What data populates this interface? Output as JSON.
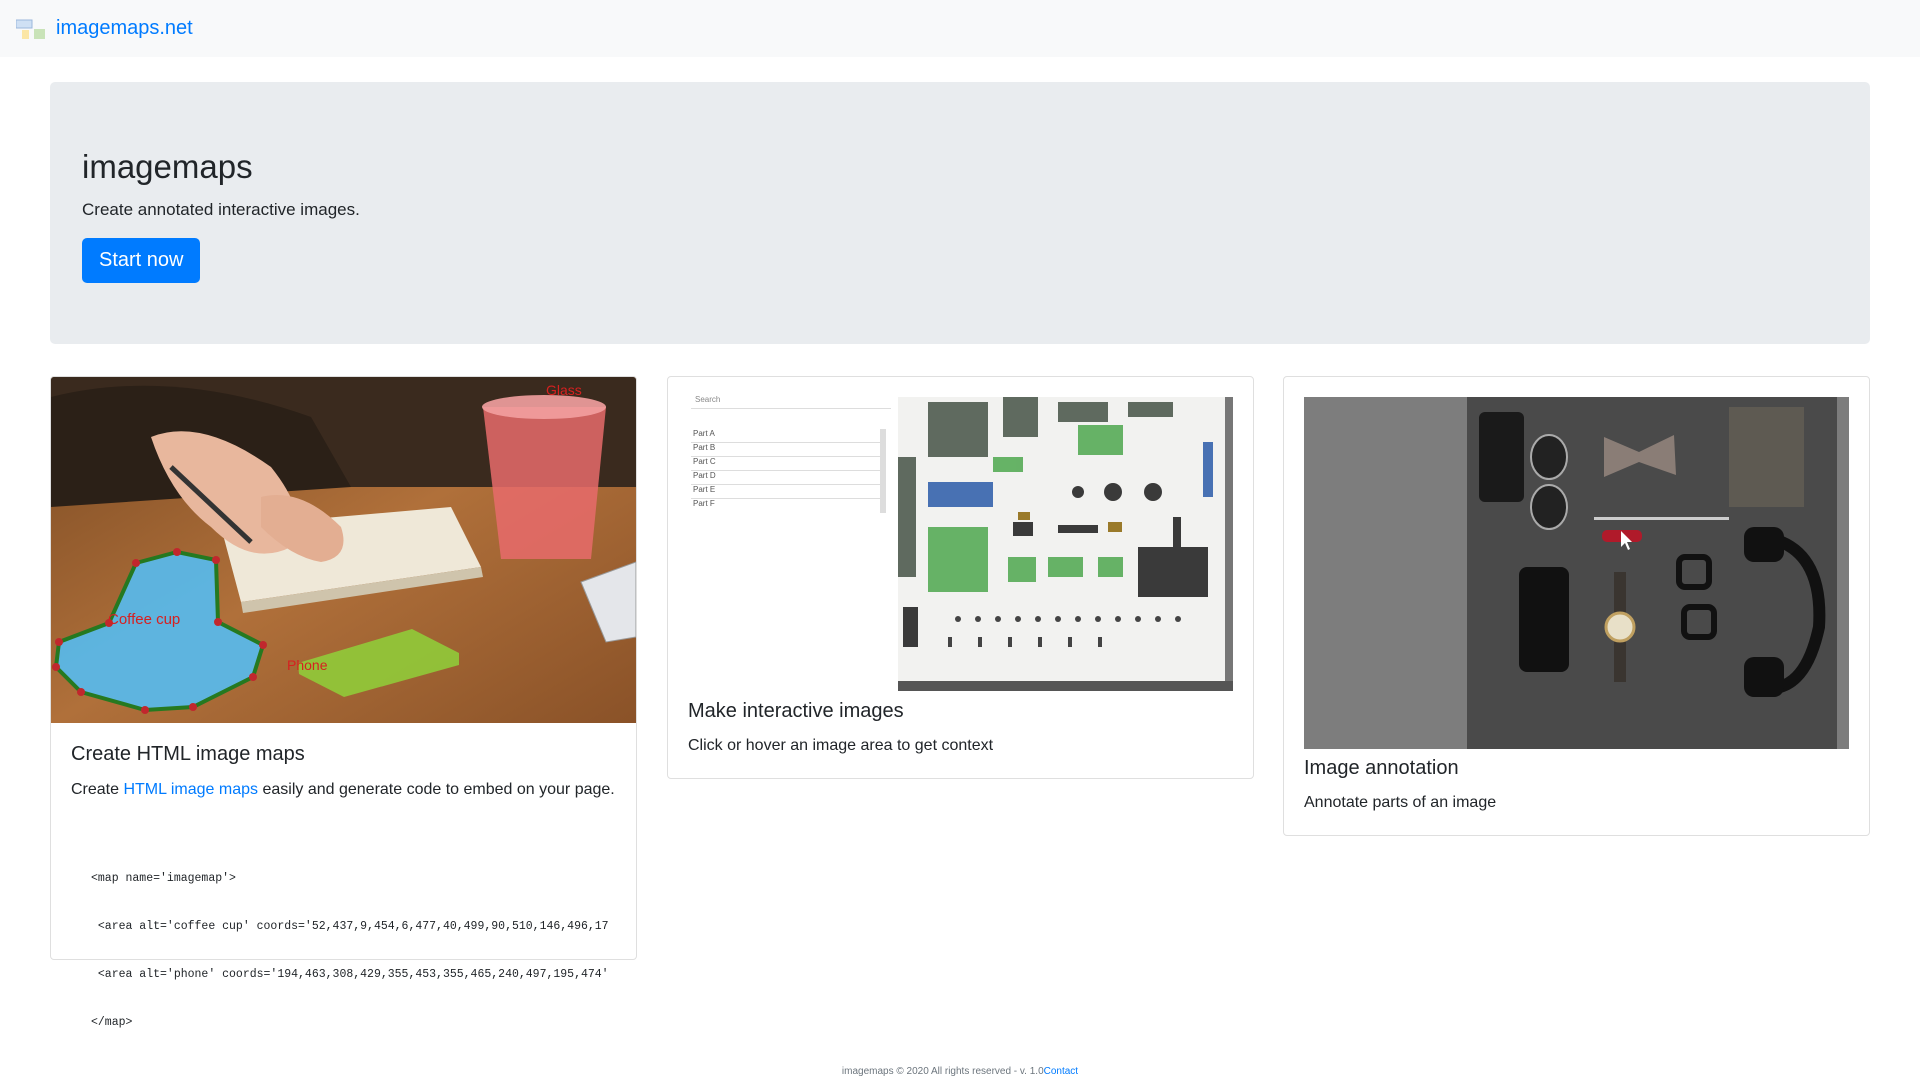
{
  "nav": {
    "brand": "imagemaps.net",
    "logo_icon": "imagemaps-logo-icon"
  },
  "hero": {
    "title": "imagemaps",
    "subtitle": "Create annotated interactive images.",
    "cta": "Start now"
  },
  "cards": [
    {
      "title": "Create HTML image maps",
      "text_before": "Create ",
      "link": "HTML image maps",
      "text_after": " easily and generate code to embed on your page.",
      "image_labels": {
        "glass": "Glass",
        "coffee": "Coffee cup",
        "phone": "Phone"
      },
      "code_lines": [
        "<map name='imagemap'>",
        " <area alt='coffee cup' coords='52,437,9,454,6,477,40,499,90,510,146,496,17",
        " <area alt='phone' coords='194,463,308,429,355,453,355,465,240,497,195,474'",
        "</map>"
      ]
    },
    {
      "title": "Make interactive images",
      "text": "Click or hover an image area to get context",
      "search_placeholder": "Search",
      "parts": [
        "Part A",
        "Part B",
        "Part C",
        "Part D",
        "Part E",
        "Part F"
      ]
    },
    {
      "title": "Image annotation",
      "text": "Annotate parts of an image"
    }
  ],
  "footer": {
    "text": "imagemaps © 2020 All rights reserved - v. 1.0",
    "link": "Contact"
  },
  "colors": {
    "accent": "#007bff",
    "jumbotron": "#e9ecef",
    "navbar": "#f8f9fa",
    "highlight_blue": "#5ab8e8",
    "highlight_green": "#8fd13a",
    "highlight_red": "#e86b6b"
  }
}
